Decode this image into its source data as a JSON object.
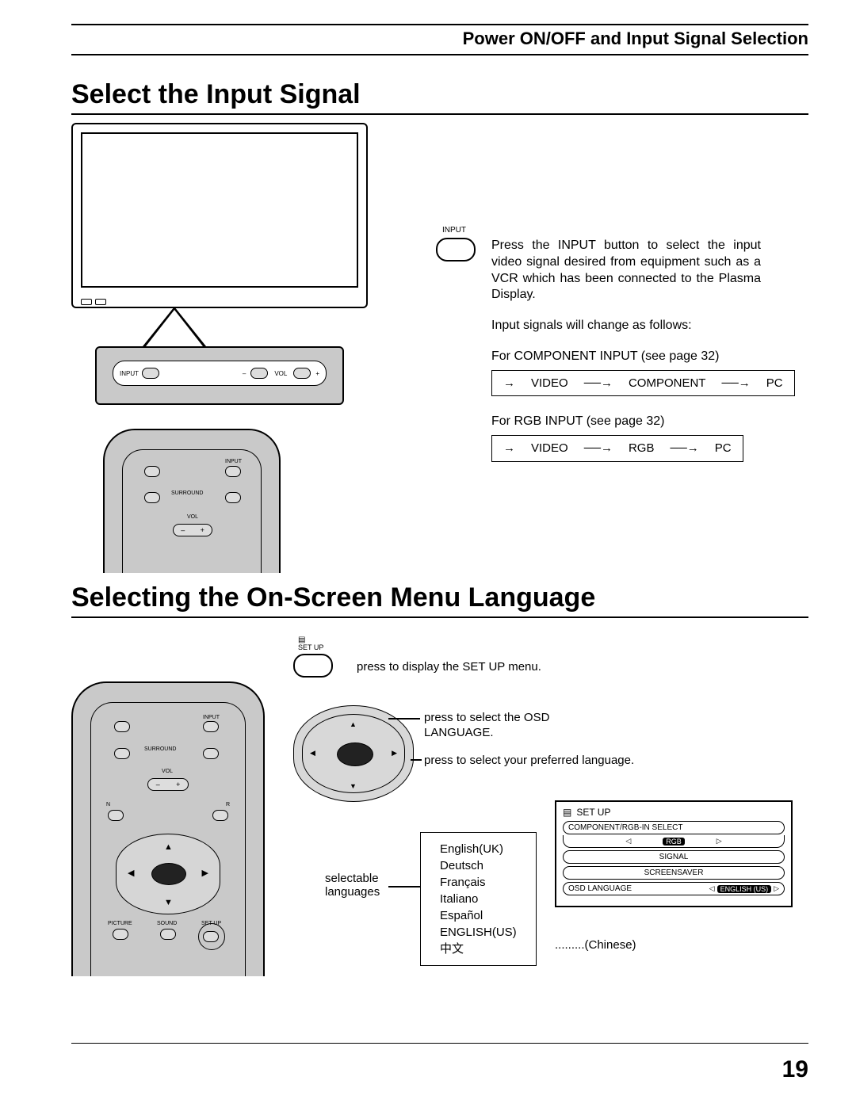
{
  "header": {
    "title": "Power ON/OFF and Input Signal Selection"
  },
  "section1": {
    "title": "Select the Input Signal",
    "input_label": "INPUT",
    "panel_input_label": "INPUT",
    "panel_vol_minus": "–",
    "panel_vol_label": "VOL",
    "panel_vol_plus": "+",
    "paragraph": "Press the INPUT button to select the input video signal desired from equipment such as a VCR which has been connected to the Plasma Display.",
    "signals_change": "Input signals will change as follows:",
    "component_note": "For COMPONENT INPUT (see page 32)",
    "flow1_a": "VIDEO",
    "flow1_b": "COMPONENT",
    "flow1_c": "PC",
    "rgb_note": "For RGB INPUT (see page 32)",
    "flow2_a": "VIDEO",
    "flow2_b": "RGB",
    "flow2_c": "PC",
    "remote": {
      "input": "INPUT",
      "surround": "SURROUND",
      "vol": "VOL",
      "minus": "–",
      "plus": "+"
    }
  },
  "section2": {
    "title": "Selecting the On-Screen Menu Language",
    "setup_label": "SET UP",
    "step1": "press to display the SET UP menu.",
    "step2a": "press to select the OSD",
    "step2b": "LANGUAGE.",
    "step3": "press to select your preferred language.",
    "selectable": "selectable",
    "languages_word": "languages",
    "languages": {
      "enuk": "English(UK)",
      "de": "Deutsch",
      "fr": "Français",
      "it": "Italiano",
      "es": "Español",
      "enus": "ENGLISH(US)",
      "zh": "中文"
    },
    "chinese_note": ".........(Chinese)",
    "remote": {
      "input": "INPUT",
      "surround": "SURROUND",
      "vol": "VOL",
      "minus": "–",
      "plus": "+",
      "n": "N",
      "r": "R",
      "picture": "PICTURE",
      "sound": "SOUND",
      "setup": "SET UP"
    },
    "menu": {
      "title": "SET  UP",
      "row1_label": "COMPONENT/RGB-IN  SELECT",
      "row1_val": "RGB",
      "row2": "SIGNAL",
      "row3": "SCREENSAVER",
      "row4_label": "OSD  LANGUAGE",
      "row4_val": "ENGLISH (US)"
    }
  },
  "page_number": "19"
}
